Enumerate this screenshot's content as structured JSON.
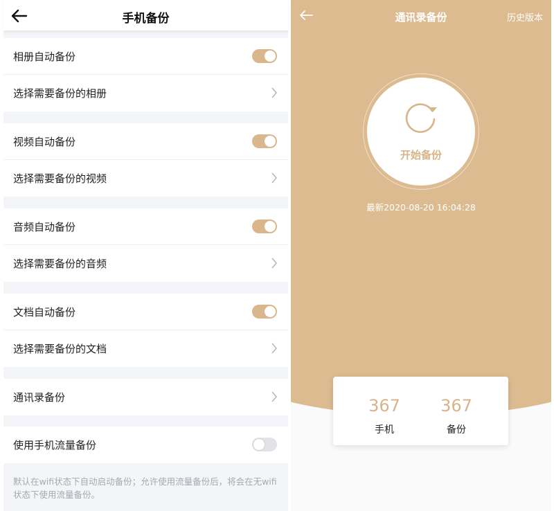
{
  "left": {
    "title": "手机备份",
    "rows": [
      {
        "label": "相册自动备份",
        "type": "toggle",
        "state": "on"
      },
      {
        "label": "选择需要备份的相册",
        "type": "link"
      },
      {
        "label": "视频自动备份",
        "type": "toggle",
        "state": "on"
      },
      {
        "label": "选择需要备份的视频",
        "type": "link"
      },
      {
        "label": "音频自动备份",
        "type": "toggle",
        "state": "on"
      },
      {
        "label": "选择需要备份的音频",
        "type": "link"
      },
      {
        "label": "文档自动备份",
        "type": "toggle",
        "state": "on"
      },
      {
        "label": "选择需要备份的文档",
        "type": "link"
      },
      {
        "label": "通讯录备份",
        "type": "link"
      },
      {
        "label": "使用手机流量备份",
        "type": "toggle",
        "state": "off"
      }
    ],
    "note": "默认在wifi状态下自动启动备份；允许使用流量备份后，将会在无wifi状态下使用流量备份。"
  },
  "right": {
    "title": "通讯录备份",
    "history_label": "历史版本",
    "start_label": "开始备份",
    "latest": "最新2020-08-20 16:04:28",
    "stats": [
      {
        "value": "367",
        "caption": "手机"
      },
      {
        "value": "367",
        "caption": "备份"
      }
    ]
  },
  "colors": {
    "accent": "#dcbb90",
    "toggle_on": "#d9b68c",
    "toggle_off": "#e2e3e7",
    "section_gap": "#f3f5f9"
  },
  "icons": {
    "back": "arrow-left-icon",
    "chevron": "chevron-right-icon",
    "sync": "refresh-icon"
  }
}
